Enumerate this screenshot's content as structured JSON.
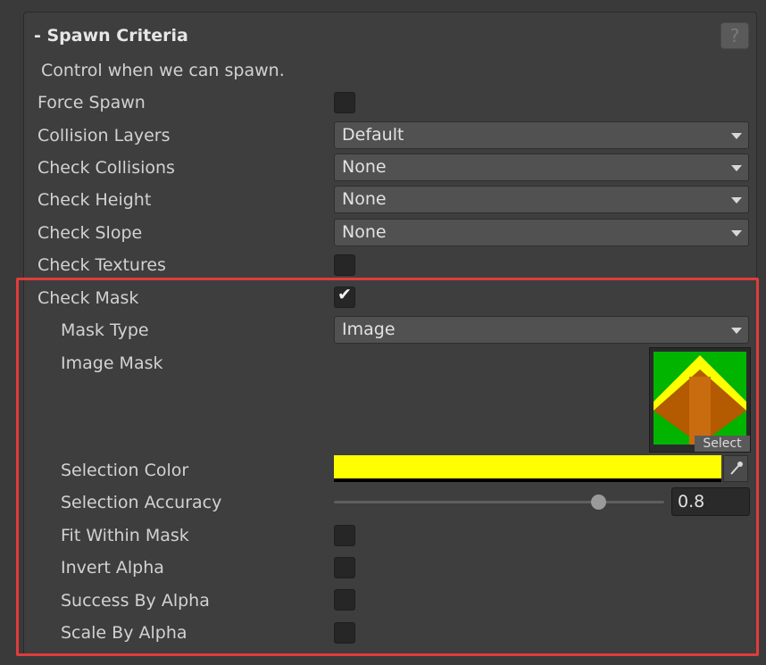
{
  "section": {
    "title": "- Spawn Criteria",
    "help_label": "?",
    "description": "Control when we can spawn."
  },
  "fields": {
    "force_spawn": {
      "label": "Force Spawn",
      "checked": false
    },
    "collision_layers": {
      "label": "Collision Layers",
      "value": "Default"
    },
    "check_collisions": {
      "label": "Check Collisions",
      "value": "None"
    },
    "check_height": {
      "label": "Check Height",
      "value": "None"
    },
    "check_slope": {
      "label": "Check Slope",
      "value": "None"
    },
    "check_textures": {
      "label": "Check Textures",
      "checked": false
    },
    "check_mask": {
      "label": "Check Mask",
      "checked": true,
      "tick": "✔"
    },
    "mask_type": {
      "label": "Mask Type",
      "value": "Image"
    },
    "image_mask": {
      "label": "Image Mask",
      "select_label": "Select"
    },
    "selection_color": {
      "label": "Selection Color",
      "color": "#ffff00"
    },
    "selection_accuracy": {
      "label": "Selection Accuracy",
      "value": "0.8",
      "fraction": 0.8
    },
    "fit_within_mask": {
      "label": "Fit Within Mask",
      "checked": false
    },
    "invert_alpha": {
      "label": "Invert Alpha",
      "checked": false
    },
    "success_by_alpha": {
      "label": "Success By Alpha",
      "checked": false
    },
    "scale_by_alpha": {
      "label": "Scale By Alpha",
      "checked": false
    }
  },
  "colors": {
    "highlight_border": "#e03c3c",
    "mask_green": "#00b400",
    "mask_yellow": "#ffff00",
    "mask_brown": "#b45a00"
  }
}
